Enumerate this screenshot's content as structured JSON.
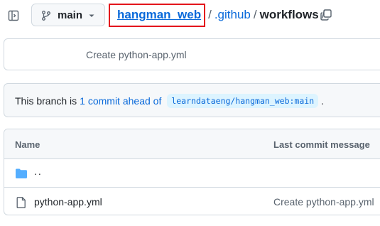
{
  "topbar": {
    "sidebar_toggle_icon": "sidebar-expand-icon",
    "branch": {
      "icon": "git-branch-icon",
      "label": "main",
      "caret_icon": "triangle-down-icon"
    },
    "breadcrumb": {
      "root": "hangman_web",
      "separator": "/",
      "items": [
        ".github",
        "workflows"
      ],
      "trailing_separator": "/"
    },
    "copy_icon": "copy-icon",
    "highlight_color": "#e3151c"
  },
  "latest_commit": {
    "message": "Create python-app.yml"
  },
  "ahead_banner": {
    "prefix": "This branch is",
    "link_text": "1 commit ahead of",
    "ref": "learndataeng/hangman_web:main",
    "suffix": "."
  },
  "file_table": {
    "columns": {
      "name": "Name",
      "message": "Last commit message"
    },
    "rows": [
      {
        "type": "parent",
        "icon": "folder-icon",
        "name": "..",
        "message": ""
      },
      {
        "type": "file",
        "icon": "file-icon",
        "name": "python-app.yml",
        "message": "Create python-app.yml"
      }
    ]
  },
  "colors": {
    "link": "#0969da",
    "border": "#d1d9e0",
    "muted": "#59636e",
    "folder": "#54aeff"
  }
}
